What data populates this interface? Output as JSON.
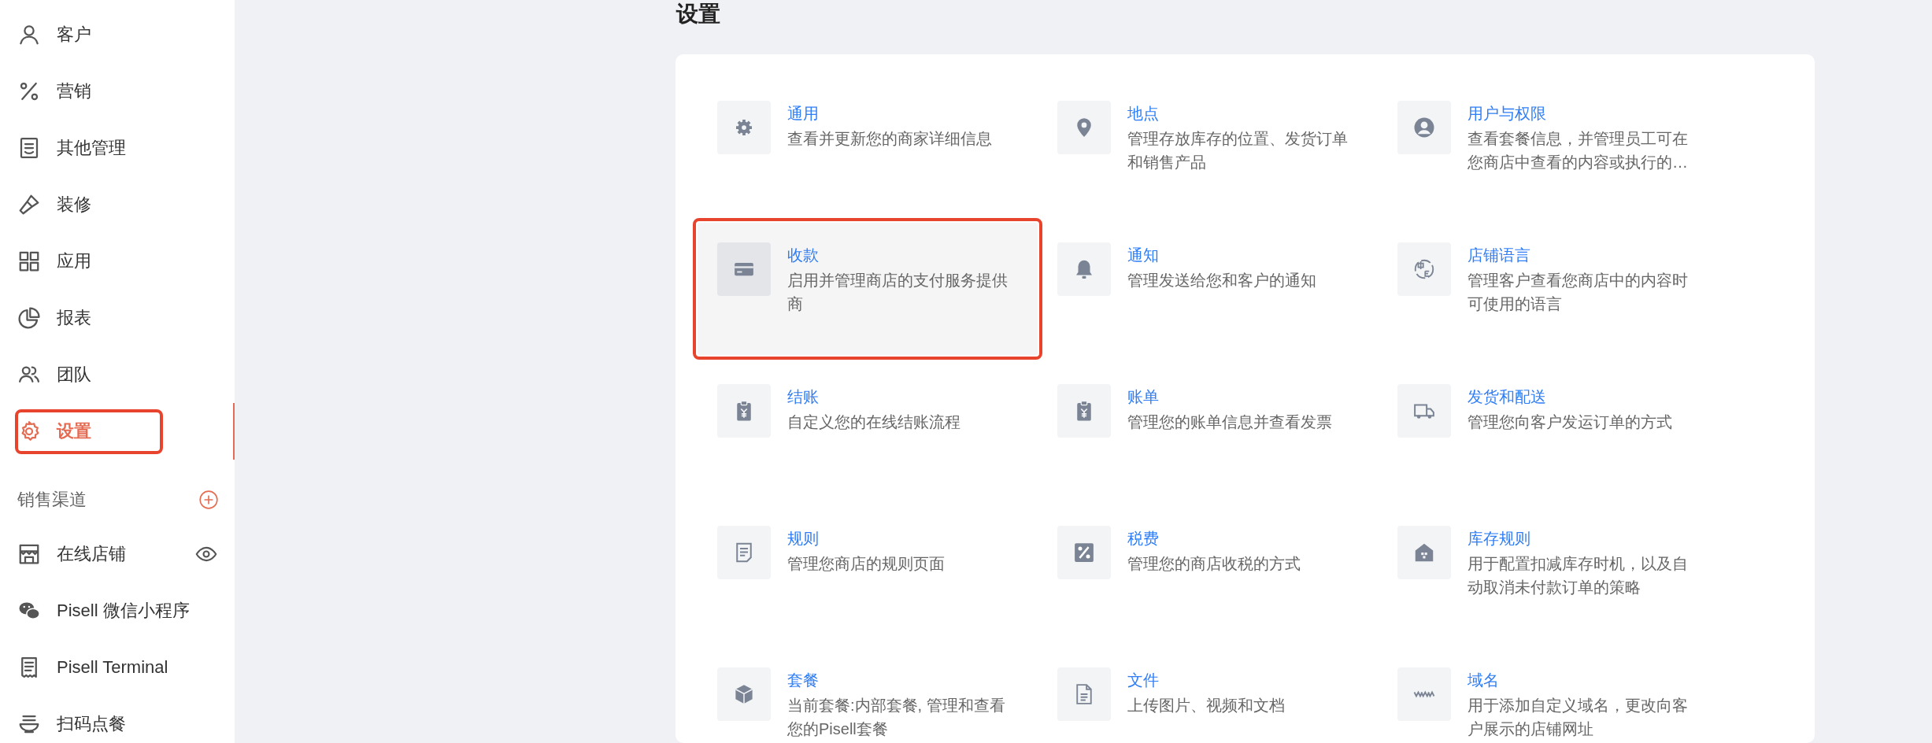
{
  "sidebar": {
    "nav_items": [
      {
        "label": "客户",
        "selected": false,
        "outlined": false
      },
      {
        "label": "营销",
        "selected": false,
        "outlined": false
      },
      {
        "label": "其他管理",
        "selected": false,
        "outlined": false
      },
      {
        "label": "装修",
        "selected": false,
        "outlined": false
      },
      {
        "label": "应用",
        "selected": false,
        "outlined": false
      },
      {
        "label": "报表",
        "selected": false,
        "outlined": false
      },
      {
        "label": "团队",
        "selected": false,
        "outlined": false
      },
      {
        "label": "设置",
        "selected": true,
        "outlined": true
      }
    ],
    "section_title": "销售渠道",
    "channels": [
      {
        "label": "在线店铺"
      },
      {
        "label": "Pisell 微信小程序"
      },
      {
        "label": "Pisell Terminal"
      },
      {
        "label": "扫码点餐"
      }
    ]
  },
  "page": {
    "title": "设置"
  },
  "settings": [
    {
      "title": "通用",
      "description": "查看并更新您的商家详细信息",
      "hovered": false,
      "outlined": false
    },
    {
      "title": "地点",
      "description": "管理存放库存的位置、发货订单和销售产品",
      "hovered": false,
      "outlined": false
    },
    {
      "title": "用户与权限",
      "description": "查看套餐信息，并管理员工可在您商店中查看的内容或执行的…",
      "hovered": false,
      "outlined": false
    },
    {
      "title": "收款",
      "description": "启用并管理商店的支付服务提供商",
      "hovered": true,
      "outlined": true
    },
    {
      "title": "通知",
      "description": "管理发送给您和客户的通知",
      "hovered": false,
      "outlined": false
    },
    {
      "title": "店铺语言",
      "description": "管理客户查看您商店中的内容时可使用的语言",
      "hovered": false,
      "outlined": false
    },
    {
      "title": "结账",
      "description": "自定义您的在线结账流程",
      "hovered": false,
      "outlined": false
    },
    {
      "title": "账单",
      "description": "管理您的账单信息并查看发票",
      "hovered": false,
      "outlined": false
    },
    {
      "title": "发货和配送",
      "description": "管理您向客户发运订单的方式",
      "hovered": false,
      "outlined": false
    },
    {
      "title": "规则",
      "description": "管理您商店的规则页面",
      "hovered": false,
      "outlined": false
    },
    {
      "title": "税费",
      "description": "管理您的商店收税的方式",
      "hovered": false,
      "outlined": false
    },
    {
      "title": "库存规则",
      "description": "用于配置扣减库存时机，以及自动取消未付款订单的策略",
      "hovered": false,
      "outlined": false
    },
    {
      "title": "套餐",
      "description": "当前套餐:内部套餐, 管理和查看您的Pisell套餐",
      "hovered": false,
      "outlined": false
    },
    {
      "title": "文件",
      "description": "上传图片、视频和文档",
      "hovered": false,
      "outlined": false
    },
    {
      "title": "域名",
      "description": "用于添加自定义域名，更改向客户展示的店铺网址",
      "hovered": false,
      "outlined": false
    }
  ]
}
